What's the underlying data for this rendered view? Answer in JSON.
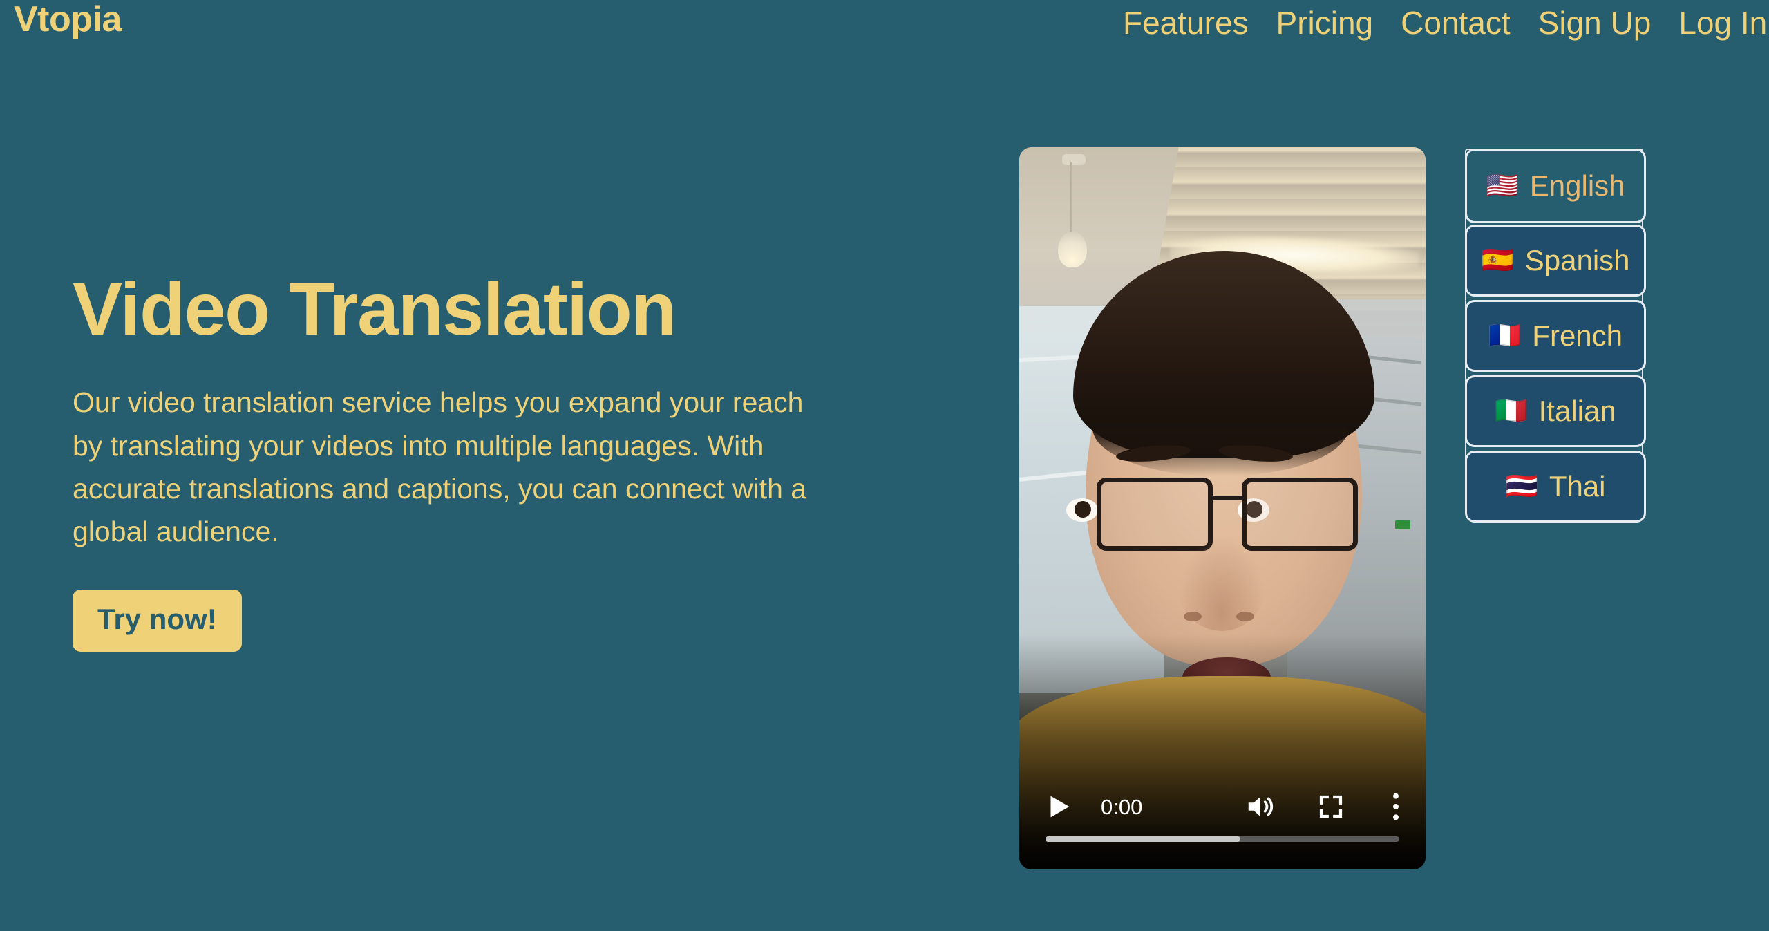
{
  "brand": {
    "name": "Vtopia"
  },
  "nav": {
    "items": [
      {
        "label": "Features",
        "name": "nav-link-features"
      },
      {
        "label": "Pricing",
        "name": "nav-link-pricing"
      },
      {
        "label": "Contact",
        "name": "nav-link-contact"
      },
      {
        "label": "Sign Up",
        "name": "nav-link-signup"
      },
      {
        "label": "Log In",
        "name": "nav-link-login"
      }
    ]
  },
  "hero": {
    "title": "Video Translation",
    "paragraph": "Our video translation service helps you expand your reach by translating your videos into multiple languages. With accurate translations and captions, you can connect with a global audience.",
    "cta_label": "Try now!"
  },
  "video": {
    "current_time": "0:00",
    "progress_percent": 55,
    "play_icon": "play-icon",
    "volume_icon": "volume-high-icon",
    "fullscreen_icon": "fullscreen-icon",
    "more_icon": "more-vertical-icon"
  },
  "language_select": {
    "selected": {
      "label": "English",
      "flag": "🇺🇸"
    },
    "options": [
      {
        "label": "Spanish",
        "flag": "🇪🇸"
      },
      {
        "label": "French",
        "flag": "🇫🇷"
      },
      {
        "label": "Italian",
        "flag": "🇮🇹"
      },
      {
        "label": "Thai",
        "flag": "🇹🇭"
      }
    ]
  },
  "colors": {
    "background_teal": "#265E70",
    "accent_gold": "#EFD278",
    "option_navy": "#1F4D6B",
    "border_light": "#E6EEF3",
    "selected_label_gold": "#E8B770"
  }
}
